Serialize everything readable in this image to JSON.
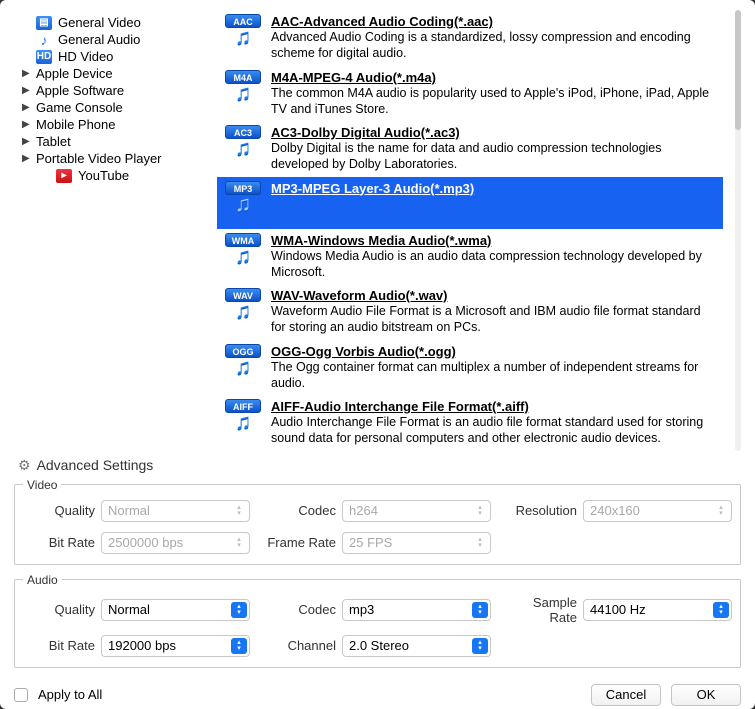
{
  "sidebar": [
    {
      "label": "General Video",
      "icon": "film",
      "arrow": false,
      "child": false
    },
    {
      "label": "General Audio",
      "icon": "note",
      "arrow": false,
      "child": false
    },
    {
      "label": "HD Video",
      "icon": "hd",
      "arrow": false,
      "child": false
    },
    {
      "label": "Apple Device",
      "icon": "",
      "arrow": true,
      "child": false
    },
    {
      "label": "Apple Software",
      "icon": "",
      "arrow": true,
      "child": false
    },
    {
      "label": "Game Console",
      "icon": "",
      "arrow": true,
      "child": false
    },
    {
      "label": "Mobile Phone",
      "icon": "",
      "arrow": true,
      "child": false
    },
    {
      "label": "Tablet",
      "icon": "",
      "arrow": true,
      "child": false
    },
    {
      "label": "Portable Video Player",
      "icon": "",
      "arrow": true,
      "child": false
    },
    {
      "label": "YouTube",
      "icon": "yt",
      "arrow": false,
      "child": true
    }
  ],
  "formats": [
    {
      "badge": "AAC",
      "title": "AAC-Advanced Audio Coding(*.aac)",
      "desc": "Advanced Audio Coding is a standardized, lossy compression and encoding scheme for digital audio.",
      "selected": false
    },
    {
      "badge": "M4A",
      "title": "M4A-MPEG-4 Audio(*.m4a)",
      "desc": "The common M4A audio is popularity used to Apple's iPod, iPhone, iPad, Apple TV and iTunes Store.",
      "selected": false
    },
    {
      "badge": "AC3",
      "title": "AC3-Dolby Digital Audio(*.ac3)",
      "desc": "Dolby Digital is the name for data and audio compression technologies developed by Dolby Laboratories.",
      "selected": false
    },
    {
      "badge": "MP3",
      "title": "MP3-MPEG Layer-3 Audio(*.mp3)",
      "desc": "",
      "selected": true
    },
    {
      "badge": "WMA",
      "title": "WMA-Windows Media Audio(*.wma)",
      "desc": "Windows Media Audio is an audio data compression technology developed by Microsoft.",
      "selected": false
    },
    {
      "badge": "WAV",
      "title": "WAV-Waveform Audio(*.wav)",
      "desc": "Waveform Audio File Format is a Microsoft and IBM audio file format standard for storing an audio bitstream on PCs.",
      "selected": false
    },
    {
      "badge": "OGG",
      "title": "OGG-Ogg Vorbis Audio(*.ogg)",
      "desc": "The Ogg container format can multiplex a number of independent streams for audio.",
      "selected": false
    },
    {
      "badge": "AIFF",
      "title": "AIFF-Audio Interchange File Format(*.aiff)",
      "desc": "Audio Interchange File Format is an audio file format standard used for storing sound data for personal computers and other electronic audio devices.",
      "selected": false
    }
  ],
  "advanced": {
    "header": "Advanced Settings"
  },
  "video": {
    "legend": "Video",
    "quality": {
      "label": "Quality",
      "value": "Normal"
    },
    "codec": {
      "label": "Codec",
      "value": "h264"
    },
    "resolution": {
      "label": "Resolution",
      "value": "240x160"
    },
    "bitrate": {
      "label": "Bit Rate",
      "value": "2500000 bps"
    },
    "framerate": {
      "label": "Frame Rate",
      "value": "25 FPS"
    }
  },
  "audio": {
    "legend": "Audio",
    "quality": {
      "label": "Quality",
      "value": "Normal"
    },
    "codec": {
      "label": "Codec",
      "value": "mp3"
    },
    "samplerate": {
      "label": "Sample Rate",
      "value": "44100 Hz"
    },
    "bitrate": {
      "label": "Bit Rate",
      "value": "192000 bps"
    },
    "channel": {
      "label": "Channel",
      "value": "2.0 Stereo"
    }
  },
  "footer": {
    "apply": "Apply to All",
    "cancel": "Cancel",
    "ok": "OK"
  }
}
